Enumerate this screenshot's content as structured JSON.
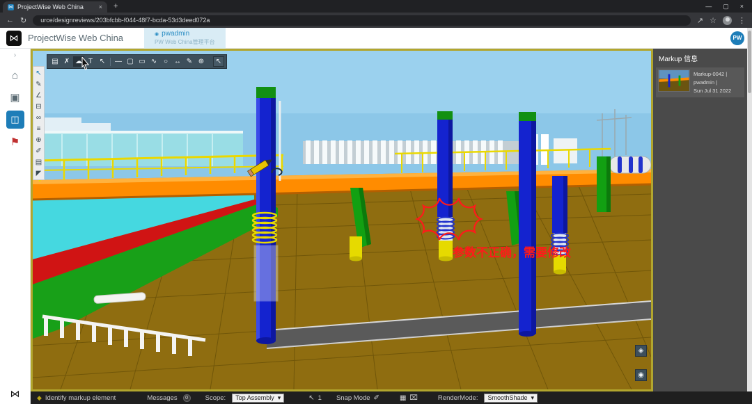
{
  "browser": {
    "tab_title": "ProjectWise Web China",
    "tab_close": "×",
    "new_tab_label": "+",
    "back": "←",
    "refresh": "↻",
    "url": "urce/designreviews/203bfcbb-f044-48f7-bcda-53d3deed072a",
    "share": "↗",
    "star": "☆",
    "menu": "⋮",
    "minimize": "—",
    "maximize": "▢",
    "close": "×",
    "favicon_glyph": "⋈"
  },
  "header": {
    "app_title": "ProjectWise Web China",
    "user_dot": "◉",
    "user_tab_name": "pwadmin",
    "user_tab_subtitle": "PW Web China管理平台",
    "avatar_initials": "PW"
  },
  "sidebar": {
    "chevron": "›",
    "home_glyph": "⌂",
    "docs_glyph": "▣",
    "review_glyph": "◫",
    "flag_glyph": "⚑",
    "bottom_glyph": "⋈"
  },
  "toolbar": {
    "icons": [
      {
        "name": "save-icon",
        "glyph": "▤"
      },
      {
        "name": "delete-icon",
        "glyph": "✗"
      },
      {
        "name": "cloud-markup-icon",
        "glyph": "☁"
      },
      {
        "name": "text-markup-icon",
        "glyph": "T"
      },
      {
        "name": "select-markup-icon",
        "glyph": "↖"
      },
      {
        "name": "line-icon",
        "glyph": "—"
      },
      {
        "name": "rounded-rect-icon",
        "glyph": "▢"
      },
      {
        "name": "rect-icon",
        "glyph": "▭"
      },
      {
        "name": "polyline-icon",
        "glyph": "∿"
      },
      {
        "name": "ellipse-icon",
        "glyph": "○"
      },
      {
        "name": "dimension-icon",
        "glyph": "↔"
      },
      {
        "name": "freehand-icon",
        "glyph": "✎"
      },
      {
        "name": "move-icon",
        "glyph": "⊕"
      },
      {
        "name": "pointer-icon",
        "glyph": "↖"
      }
    ]
  },
  "palette": {
    "icons": [
      {
        "name": "select-tool-icon",
        "glyph": "↖"
      },
      {
        "name": "pencil-tool-icon",
        "glyph": "✎"
      },
      {
        "name": "measure-tool-icon",
        "glyph": "∠"
      },
      {
        "name": "eraser-tool-icon",
        "glyph": "⊟"
      },
      {
        "name": "link-tool-icon",
        "glyph": "∞"
      },
      {
        "name": "list-tool-icon",
        "glyph": "≡"
      },
      {
        "name": "zoom-tool-icon",
        "glyph": "⊕"
      },
      {
        "name": "pen-tool-icon",
        "glyph": "✐"
      },
      {
        "name": "clipboard-tool-icon",
        "glyph": "▤"
      },
      {
        "name": "corner-tool-icon",
        "glyph": "◤"
      }
    ]
  },
  "viewport": {
    "nav_button_glyph": "◈",
    "voice_button_glyph": "◉"
  },
  "annotation": {
    "text": "参数不正确，需要修改"
  },
  "markup_panel": {
    "title": "Markup 信息",
    "item_line1": "Markup-0042 | pwadmin |",
    "item_line2": "Sun Jul 31 2022"
  },
  "statusbar": {
    "identify_icon": "◆",
    "identify": "Identify markup element",
    "messages_label": "Messages",
    "messages_count": "0",
    "scope_label": "Scope:",
    "scope_value": "Top Assembly",
    "dropdown_arrow": "▾",
    "pointer_glyph": "↖",
    "pointer_count": "1",
    "snap_label": "Snap Mode",
    "snap_icon": "✐",
    "grid_icon": "▦",
    "trash_icon": "⌧",
    "rendermode_label": "RenderMode:",
    "rendermode_value": "SmoothShade"
  },
  "colors": {
    "accent_blue": "#1d7db8",
    "markup_red": "#ff1a1a",
    "viewport_border": "#b2a62e",
    "beam_orange": "#ff8c00",
    "column_blue": "#1423cf",
    "support_green": "#12a012"
  }
}
